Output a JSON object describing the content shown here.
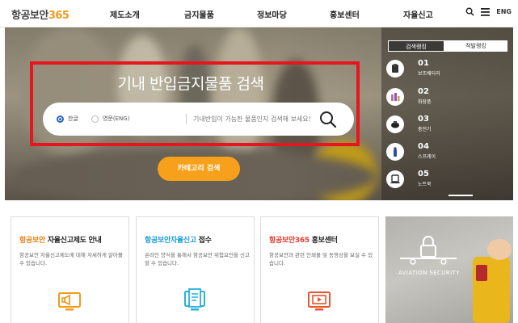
{
  "header": {
    "logo_text": "항공보안",
    "logo_number": "365",
    "nav": [
      "제도소개",
      "금지물품",
      "정보마당",
      "홍보센터",
      "자율신고"
    ],
    "lang_label": "ENG"
  },
  "hero": {
    "title": "기내 반입금지물품 검색",
    "search": {
      "option_korean": "한글",
      "option_english": "영문(ENG)",
      "selected": "한글",
      "placeholder": "기내반입이 가능한 물품인지 검색해 보세요!"
    },
    "category_button": "카테고리 검색"
  },
  "ranking": {
    "tabs": [
      "검색랭킹",
      "적발랭킹"
    ],
    "active_tab": "검색랭킹",
    "items": [
      {
        "rank": "01",
        "name": "보조배터리",
        "icon": "power-bank-icon"
      },
      {
        "rank": "02",
        "name": "화장품",
        "icon": "cosmetics-icon"
      },
      {
        "rank": "03",
        "name": "충전기",
        "icon": "charger-icon"
      },
      {
        "rank": "04",
        "name": "스프레이",
        "icon": "spray-icon"
      },
      {
        "rank": "05",
        "name": "노트북",
        "icon": "laptop-icon"
      }
    ]
  },
  "cards": [
    {
      "title_accent": "항공보안",
      "title_rest": " 자율신고제도 안내",
      "accent_color": "#e8831a",
      "description": "항공보안 자율신고제도에 대해 자세하게 알아볼 수 있습니다.",
      "icon": "megaphone-monitor-icon",
      "icon_color": "#f29a1c"
    },
    {
      "title_accent": "항공보안자율신고",
      "title_rest": " 접수",
      "accent_color": "#1a9bd7",
      "description": "온라인 양식을 통해서 항공보안 위험요인을 신고할 수 있습니다.",
      "icon": "report-form-icon",
      "icon_color": "#27b1d9"
    },
    {
      "title_accent": "항공보안365",
      "title_rest": " 홍보센터",
      "accent_color": "#e23b2d",
      "description": "항공보안과 관련 인쇄물 및 동영상을 보실 수 있습니다.",
      "icon": "video-monitor-icon",
      "icon_color": "#e8532d"
    }
  ],
  "promo": {
    "text": "AVIATION SECURITY"
  },
  "colors": {
    "accent_orange": "#f7a01b",
    "highlight_red": "#e8141e",
    "radio_blue": "#2a63c5"
  }
}
